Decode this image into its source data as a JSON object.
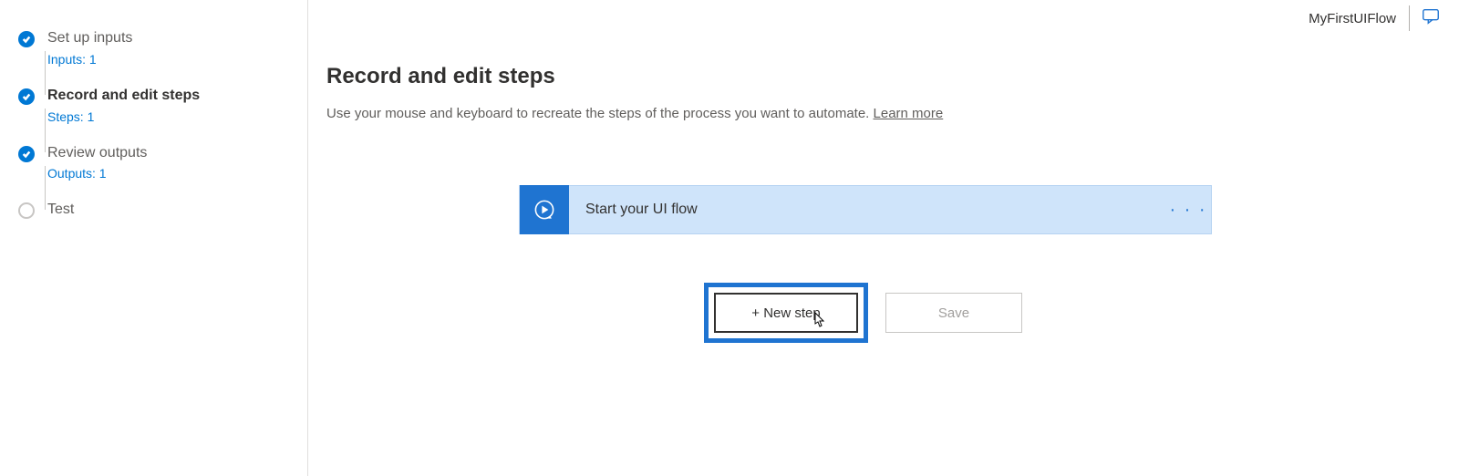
{
  "header": {
    "flow_name": "MyFirstUIFlow"
  },
  "sidebar": {
    "steps": [
      {
        "title": "Set up inputs",
        "sub": "Inputs: 1",
        "state": "completed",
        "active": false
      },
      {
        "title": "Record and edit steps",
        "sub": "Steps: 1",
        "state": "completed",
        "active": true
      },
      {
        "title": "Review outputs",
        "sub": "Outputs: 1",
        "state": "completed",
        "active": false
      },
      {
        "title": "Test",
        "sub": "",
        "state": "pending",
        "active": false
      }
    ]
  },
  "main": {
    "title": "Record and edit steps",
    "description": "Use your mouse and keyboard to recreate the steps of the process you want to automate.  ",
    "learn_more": "Learn more",
    "flow_card": {
      "title": "Start your UI flow",
      "menu": "· · ·"
    },
    "buttons": {
      "new_step": "+ New step",
      "save": "Save"
    }
  },
  "icons": {
    "check": "check-icon",
    "play_loop": "play-loop-icon",
    "feedback": "feedback-icon"
  }
}
